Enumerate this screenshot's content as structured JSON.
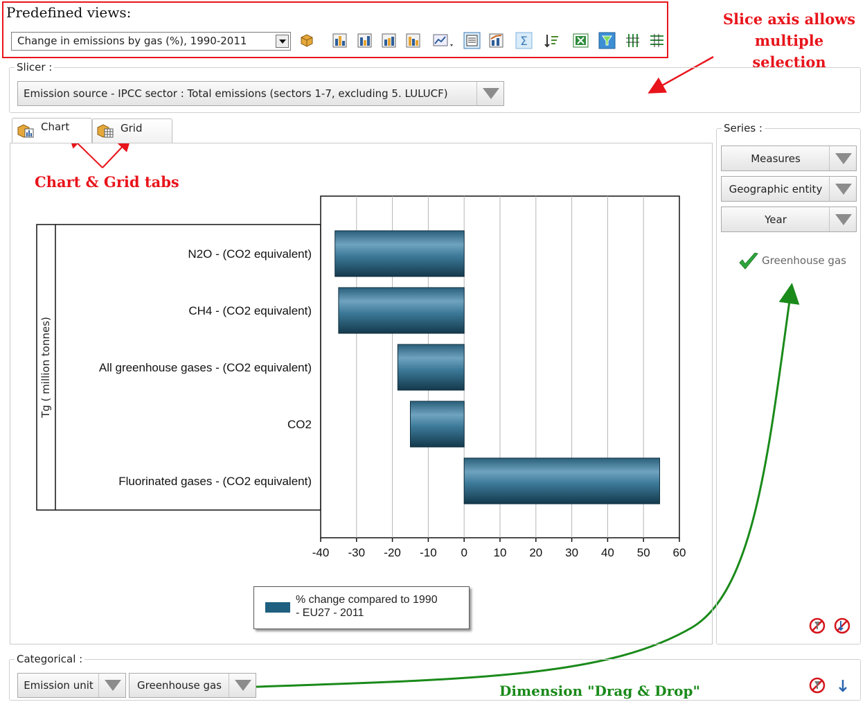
{
  "predefined_views": {
    "title": "Predefined views:",
    "selected": "Change in emissions by gas (%), 1990-2011"
  },
  "toolbar_icons": [
    "cube-icon",
    "bar-chart-icon",
    "stacked-bar-chart-icon",
    "horizontal-bar-chart-icon",
    "clustered-bar-chart-icon",
    "chart-wizard-icon",
    "list-view-icon",
    "combined-chart-icon",
    "sum-icon",
    "sort-icon",
    "excel-export-icon",
    "filter-icon",
    "column-layout-icon",
    "row-layout-icon"
  ],
  "annotations": {
    "slice": [
      "Slice axis allows",
      "multiple selection"
    ],
    "tabs": "Chart & Grid tabs",
    "dragdrop": "Dimension \"Drag & Drop\""
  },
  "slicer": {
    "label": "Slicer :",
    "value": "Emission source - IPCC sector : Total emissions (sectors 1-7, excluding 5. LULUCF)"
  },
  "tabs": [
    {
      "label": "Chart",
      "active": true
    },
    {
      "label": "Grid",
      "active": false
    }
  ],
  "series_panel": {
    "label": "Series :",
    "buttons": [
      "Measures",
      "Geographic entity",
      "Year"
    ],
    "selected_item": "Greenhouse gas"
  },
  "categorical": {
    "label": "Categorical :",
    "buttons": [
      "Emission unit",
      "Greenhouse gas"
    ]
  },
  "colors": {
    "bar": "#2f6c88",
    "annotation_red": "#e8141b",
    "annotation_green": "#1a8a1a"
  },
  "chart_data": {
    "type": "bar",
    "orientation": "horizontal",
    "categories": [
      "N2O - (CO2 equivalent)",
      "CH4 - (CO2 equivalent)",
      "All greenhouse gases - (CO2 equivalent)",
      "CO2",
      "Fluorinated gases - (CO2 equivalent)"
    ],
    "series": [
      {
        "name": "% change compared to 1990 - EU27 - 2011",
        "values": [
          -36,
          -35,
          -18.5,
          -15,
          54.5
        ]
      }
    ],
    "xlim": [
      -40,
      60
    ],
    "xticks": [
      "-40",
      "-30",
      "-20",
      "-10",
      "0",
      "10",
      "20",
      "30",
      "40",
      "50",
      "60"
    ],
    "ylabel": "Tg ( million tonnes)",
    "legend_lines": [
      "% change compared to 1990",
      "- EU27 - 2011"
    ],
    "grid": true
  }
}
